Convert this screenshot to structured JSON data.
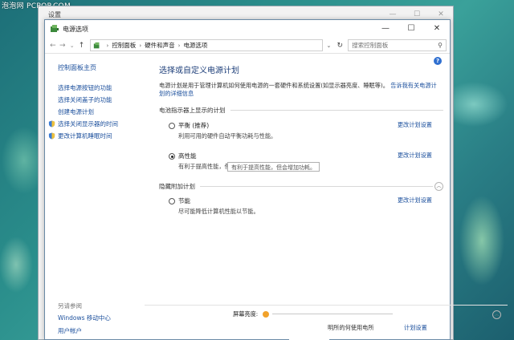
{
  "watermark": "泡泡网 PCPOP.COM",
  "settings_window": {
    "title": "设置",
    "controls": [
      "—",
      "☐",
      "✕"
    ]
  },
  "window": {
    "title": "电源选项",
    "controls": [
      "—",
      "☐",
      "✕"
    ]
  },
  "address_bar": {
    "crumbs": [
      "控制面板",
      "硬件和声音",
      "电源选项"
    ],
    "search_placeholder": "搜索控制面板"
  },
  "sidebar": {
    "home": "控制面板主页",
    "items": [
      {
        "label": "选择电源按钮的功能",
        "icon": ""
      },
      {
        "label": "选择关闭盖子的功能",
        "icon": ""
      },
      {
        "label": "创建电源计划",
        "icon": ""
      },
      {
        "label": "选择关闭显示器的时间",
        "icon": "shield-icon"
      },
      {
        "label": "更改计算机睡眠时间",
        "icon": "shield-icon"
      }
    ],
    "see_also": "另请参阅",
    "see_also_items": [
      "Windows 移动中心",
      "用户帐户"
    ]
  },
  "main": {
    "title": "选择或自定义电源计划",
    "description": "电源计划是用于管理计算机如何使用电源的一套硬件和系统设置(如显示器亮度、睡眠等)。",
    "description_link": "告诉我有关电源计划的详细信息",
    "section_label": "电池指示器上显示的计划",
    "plans": [
      {
        "name": "平衡 (推荐)",
        "desc": "利用可用的硬件自动平衡功耗与性能。",
        "change": "更改计划设置",
        "checked": false
      },
      {
        "name": "高性能",
        "desc": "有利于提高性能，但会增加功耗。",
        "change": "更改计划设置",
        "checked": true
      }
    ],
    "tooltip": "有利于提高性能，但会增加功耗。",
    "hidden_label": "隐藏附加计划",
    "hidden_plans": [
      {
        "name": "节能",
        "desc": "尽可能降低计算机性能以节能。",
        "change": "更改计划设置",
        "checked": false
      }
    ]
  },
  "bottom": {
    "brightness_label": "屏幕亮度:",
    "partial_text": "明所的何使用电所",
    "partial_link": "计划设置"
  },
  "colors": {
    "link": "#1b4f9c",
    "title": "#1e3f7a",
    "help": "#2f6fd0"
  }
}
